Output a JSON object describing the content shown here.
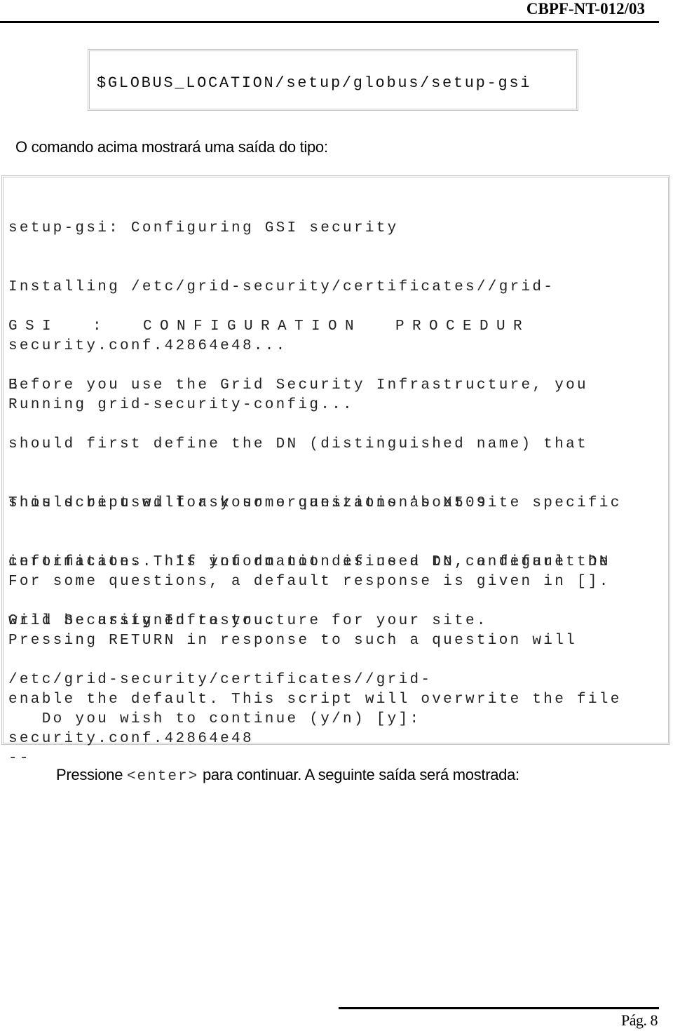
{
  "header": {
    "doc_id": "CBPF-NT-012/03"
  },
  "command_box": {
    "command": "$GLOBUS_LOCATION/setup/globus/setup-gsi"
  },
  "intro_text": "O comando acima mostrará uma saída do tipo:",
  "output_box": {
    "block1": [
      "setup-gsi: Configuring GSI security",
      "Installing /etc/grid-security/certificates//grid-",
      "security.conf.42864e48...",
      "Running grid-security-config..."
    ],
    "heading_line1": "GSI  :  CONFIGURATION  PROCEDUR",
    "heading_line2": "E",
    "block2": [
      "Before you use the Grid Security Infrastructure, you",
      "should first define the DN (distinguished name) that",
      "should be used for your organization's X509",
      "certificates.  If you do not define a DN, a default DN",
      "will be assigned to you."
    ],
    "block3": [
      "This script will ask some questions about site specific",
      "information. This information is used to configure the",
      "Grid Security Infrastructure for your site."
    ],
    "block4": [
      "For some questions, a default response is given in [].",
      "Pressing RETURN in response to such a question will",
      "enable the default. This script will overwrite the file",
      "--"
    ],
    "block5": [
      "/etc/grid-security/certificates//grid-",
      "security.conf.42864e48"
    ],
    "prompt": "   Do you wish to continue (y/n) [y]:"
  },
  "continue_text": {
    "before": "Pressione ",
    "key": "<enter>",
    "after": " para continuar. A seguinte saída será mostrada:"
  },
  "footer": {
    "page_label": "Pág. 8"
  }
}
